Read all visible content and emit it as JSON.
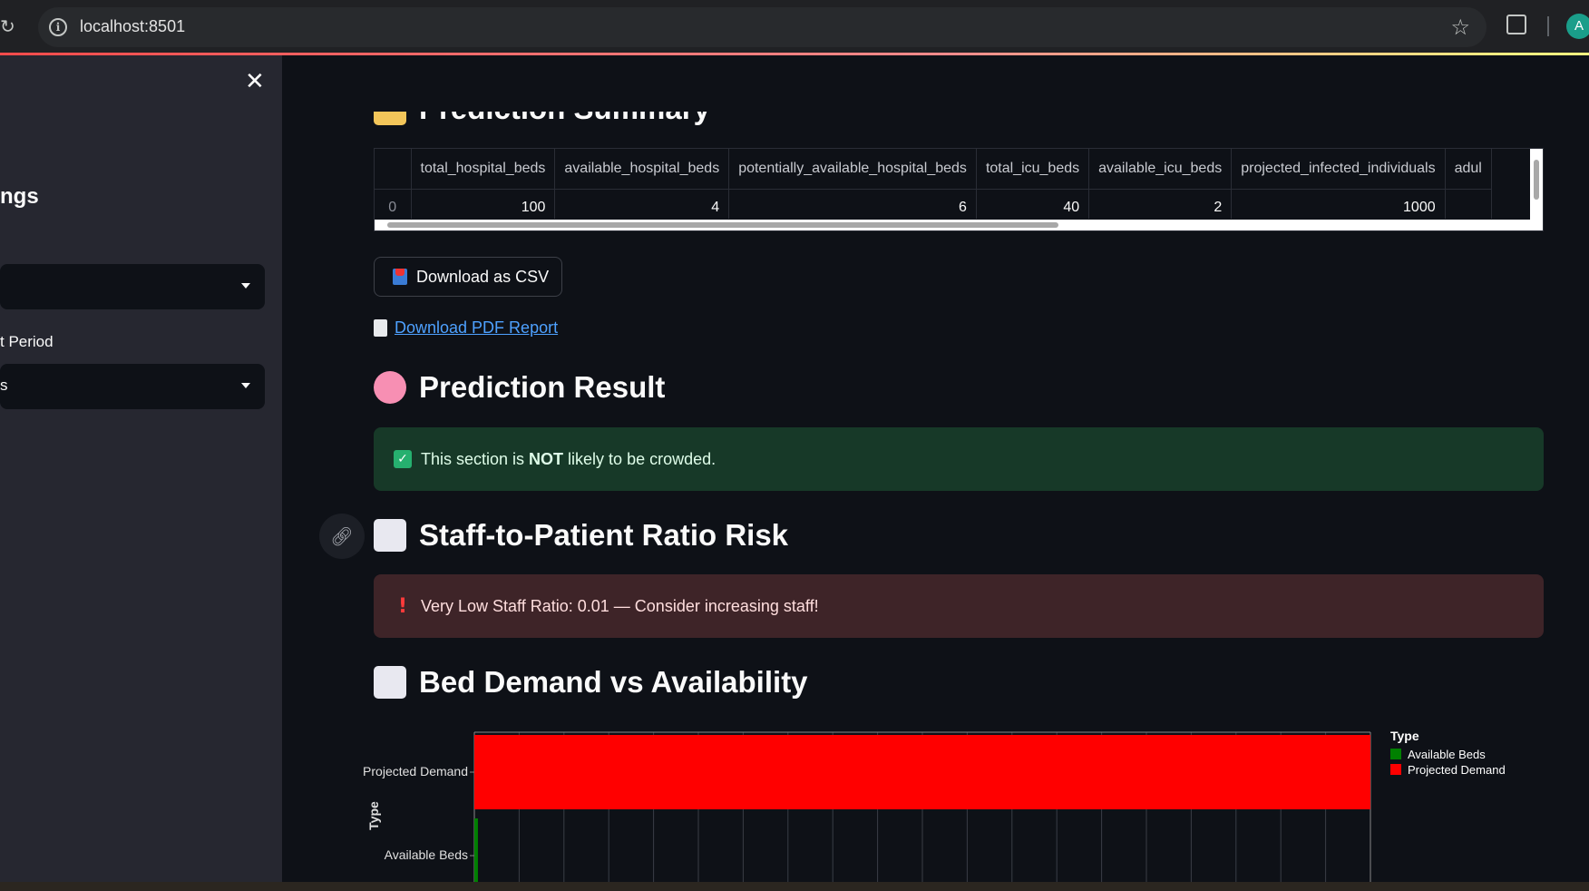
{
  "browser": {
    "url": "localhost:8501",
    "avatar_letter": "A"
  },
  "sidebar": {
    "heading": "ngs",
    "select_1_value": "",
    "period_label": "t Period",
    "select_2_value": "s"
  },
  "summary": {
    "title": "Prediction Summary",
    "columns": [
      "",
      "total_hospital_beds",
      "available_hospital_beds",
      "potentially_available_hospital_beds",
      "total_icu_beds",
      "available_icu_beds",
      "projected_infected_individuals",
      "adul"
    ],
    "rows": [
      [
        "0",
        "100",
        "4",
        "6",
        "40",
        "2",
        "1000",
        ""
      ]
    ]
  },
  "download_csv_label": "Download as CSV",
  "download_pdf_label": "Download PDF Report",
  "prediction": {
    "title": "Prediction Result",
    "message_prefix": "This section is ",
    "message_bold": "NOT",
    "message_suffix": " likely to be crowded."
  },
  "staff": {
    "title": "Staff-to-Patient Ratio Risk",
    "message": "Very Low Staff Ratio: 0.01 — Consider increasing staff!"
  },
  "beds": {
    "title": "Bed Demand vs Availability"
  },
  "chart_data": {
    "type": "bar",
    "orientation": "horizontal",
    "categories": [
      "Projected Demand",
      "Available Beds"
    ],
    "values": [
      1000,
      4
    ],
    "colors": [
      "#ff0000",
      "#008000"
    ],
    "ylabel": "Type",
    "legend_title": "Type",
    "legend": [
      {
        "name": "Available Beds",
        "color": "#008000"
      },
      {
        "name": "Projected Demand",
        "color": "#ff0000"
      }
    ],
    "legend_position": "right",
    "xlim": [
      0,
      1000
    ],
    "grid": true
  }
}
